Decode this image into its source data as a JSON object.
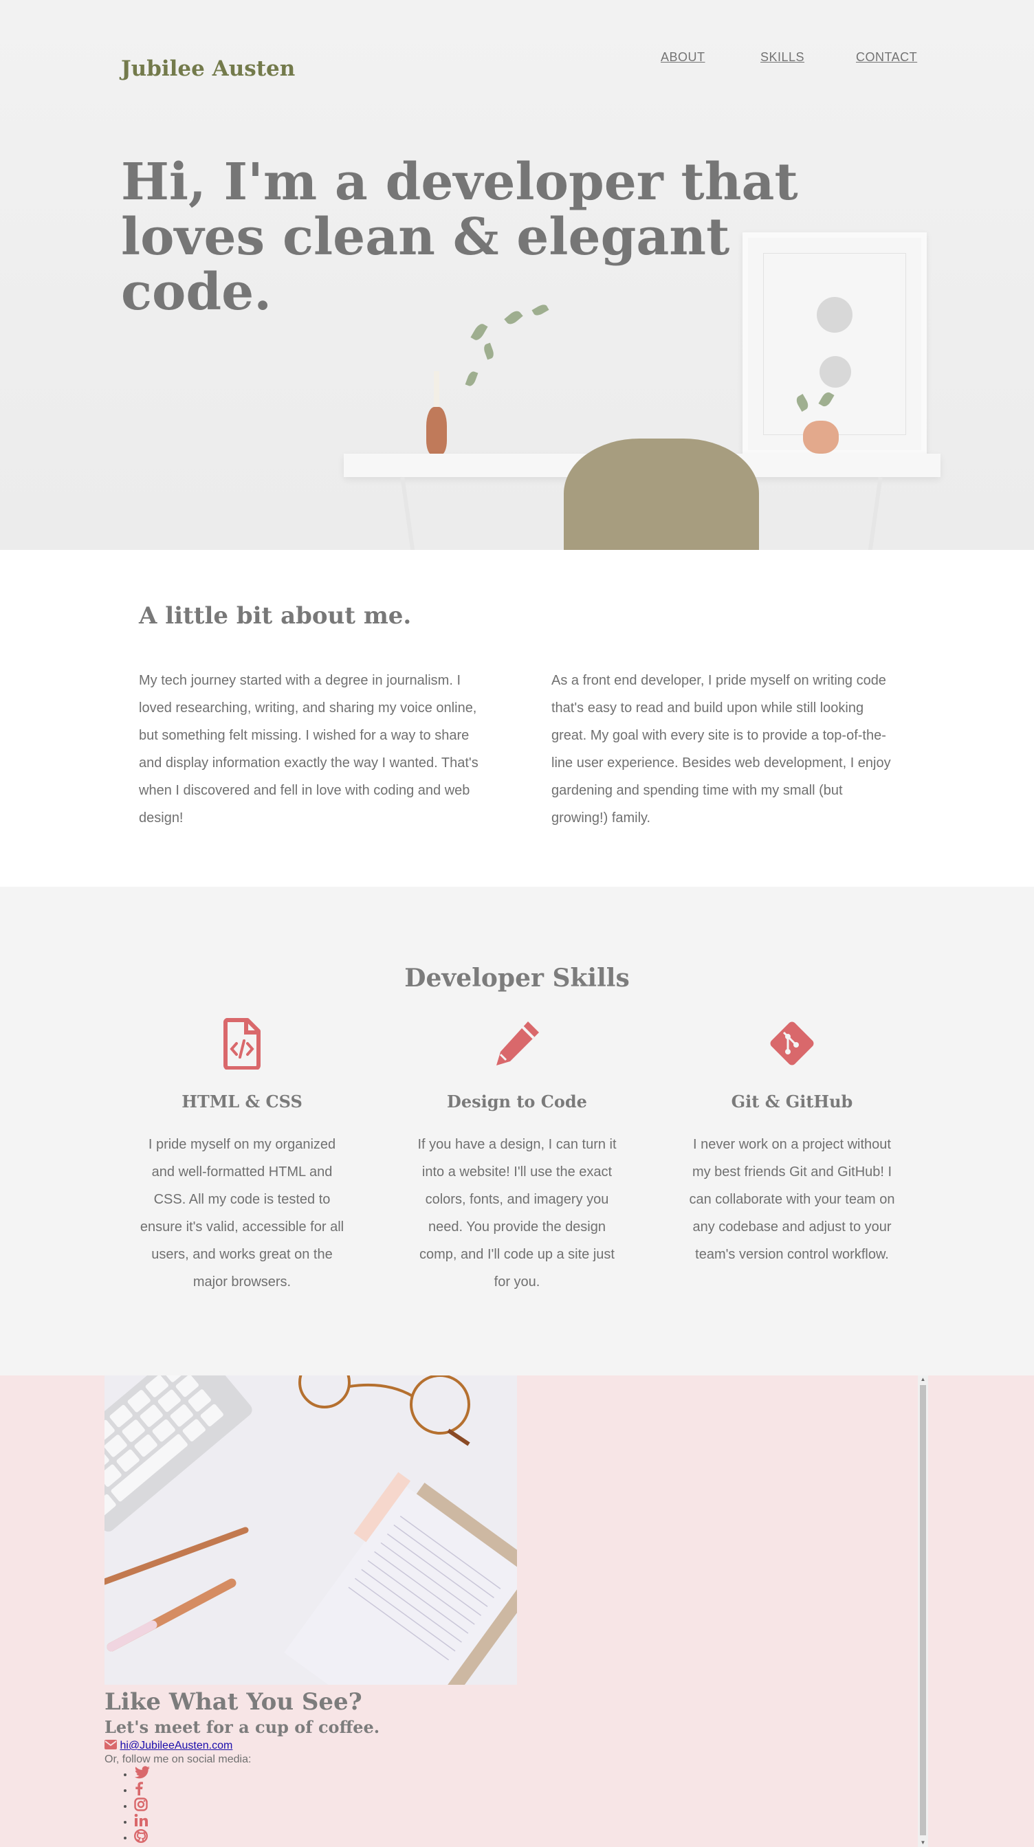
{
  "brand": "Jubilee Austen",
  "nav": {
    "about": "ABOUT",
    "skills": "SKILLS",
    "contact": "CONTACT"
  },
  "hero": {
    "title": "Hi, I'm a developer that loves clean & elegant code."
  },
  "about": {
    "heading": "A little bit about me.",
    "para1": "My tech journey started with a degree in journalism. I loved researching, writing, and sharing my voice online, but something felt missing. I wished for a way to share and display information exactly the way I wanted. That's when I discovered and fell in love with coding and web design!",
    "para2": "As a front end developer, I pride myself on writing code that's easy to read and build upon while still looking great. My goal with every site is to provide a top-of-the-line user experience. Besides web development, I enjoy gardening and spending time with my small (but growing!) family."
  },
  "skills": {
    "heading": "Developer Skills",
    "items": [
      {
        "icon": "file-code-icon",
        "title": "HTML & CSS",
        "text": "I pride myself on my organized and well-formatted HTML and CSS. All my code is tested to ensure it's valid, accessible for all users, and works great on the major browsers."
      },
      {
        "icon": "pencil-icon",
        "title": "Design to Code",
        "text": "If you have a design, I can turn it into a website! I'll use the exact colors, fonts, and imagery you need. You provide the design comp, and I'll code up a site just for you."
      },
      {
        "icon": "git-icon",
        "title": "Git & GitHub",
        "text": "I never work on a project without my best friends Git and GitHub! I can collaborate with your team on any codebase and adjust to your team's version control workflow."
      }
    ]
  },
  "contact": {
    "heading": "Like What You See?",
    "subheading": "Let's meet for a cup of coffee.",
    "email": "hi@JubileeAusten.com",
    "follow": "Or, follow me on social media:",
    "social": [
      "twitter-icon",
      "facebook-icon",
      "instagram-icon",
      "linkedin-icon",
      "github-icon"
    ]
  },
  "colors": {
    "accent": "#d9686b",
    "brand": "#737a4b",
    "contact_bg": "#f7e5e6",
    "skills_bg": "#f4f4f4"
  }
}
